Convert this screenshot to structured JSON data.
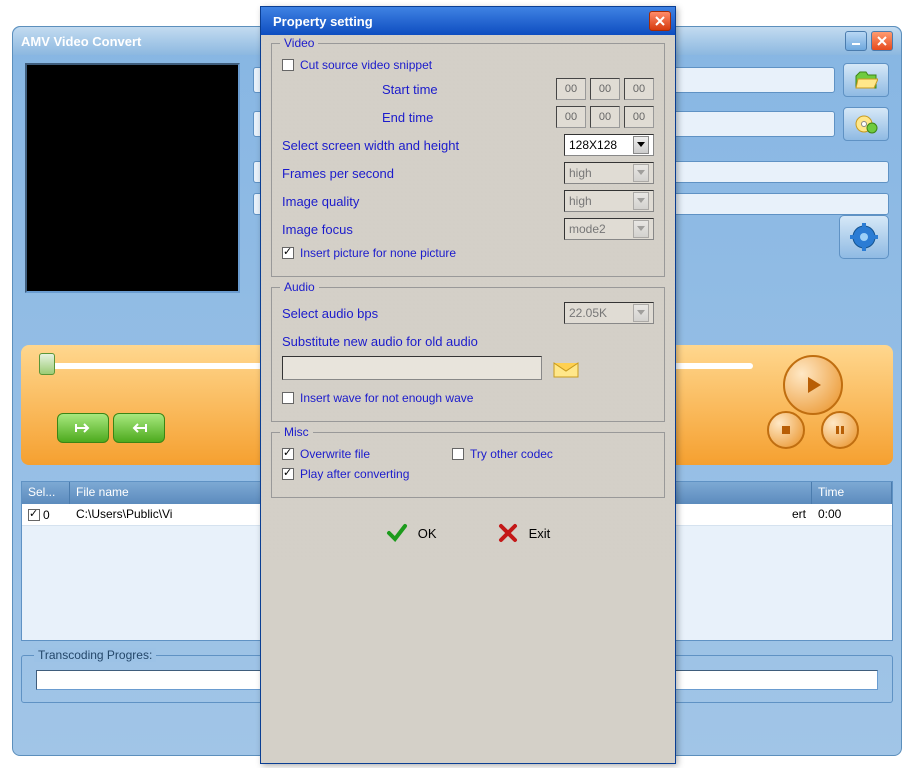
{
  "main": {
    "title": "AMV Video Convert",
    "table": {
      "cols": [
        "Sel...",
        "File name",
        "Time"
      ],
      "row": {
        "sel": "0",
        "filename": "C:\\Users\\Public\\Vi",
        "status_suffix": "ert",
        "time": "0:00"
      }
    },
    "progress_label": "Transcoding Progres:"
  },
  "dialog": {
    "title": "Property setting",
    "video": {
      "legend": "Video",
      "cut_label": "Cut source video snippet",
      "start_time": "Start time",
      "end_time": "End time",
      "start": [
        "00",
        "00",
        "00"
      ],
      "end": [
        "00",
        "00",
        "00"
      ],
      "screen_label": "Select screen width and height",
      "screen_value": "128X128",
      "fps_label": "Frames per second",
      "fps_value": "high",
      "quality_label": "Image quality",
      "quality_value": "high",
      "focus_label": "Image focus",
      "focus_value": "mode2",
      "insert_label": "Insert picture for none picture"
    },
    "audio": {
      "legend": "Audio",
      "bps_label": "Select audio bps",
      "bps_value": "22.05K",
      "substitute_label": "Substitute new audio for old audio",
      "insert_wave_label": "Insert wave for not enough wave"
    },
    "misc": {
      "legend": "Misc",
      "overwrite_label": "Overwrite file",
      "codec_label": "Try other codec",
      "play_label": "Play after converting"
    },
    "footer": {
      "ok": "OK",
      "exit": "Exit"
    }
  }
}
